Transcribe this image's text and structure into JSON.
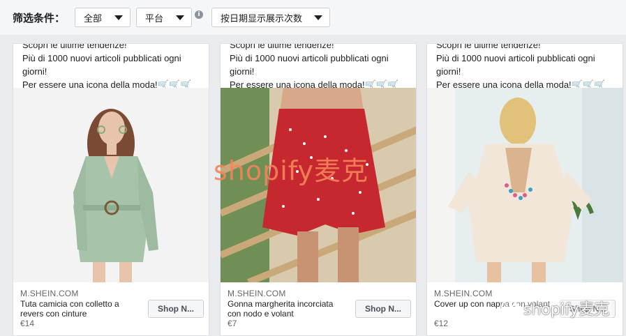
{
  "filter_bar": {
    "label": "筛选条件：",
    "dropdowns": [
      {
        "value": "全部"
      },
      {
        "value": "平台"
      },
      {
        "value": "按日期显示展示次数"
      }
    ],
    "info_icon": "i"
  },
  "ad_copy": {
    "line1": "Scopri le ultime tendenze!",
    "line2": "Più di 1000 nuovi articoli pubblicati ogni giorni!",
    "line3": "Per essere una icona della moda!🛒🛒🛒"
  },
  "cards": [
    {
      "domain": "M.SHEIN.COM",
      "title": "Tuta camicia con colletto a revers con cinture",
      "price": "€14",
      "cta": "Shop N..."
    },
    {
      "domain": "M.SHEIN.COM",
      "title": "Gonna margherita incorciata con nodo e volant",
      "price": "€7",
      "cta": "Shop N..."
    },
    {
      "domain": "M.SHEIN.COM",
      "title": "Cover up con nappa con volant",
      "price": "€12",
      "cta": "Shop N..."
    }
  ],
  "watermarks": {
    "center": "shopify麦克",
    "corner": "shopify麦克"
  },
  "icons": [
    "caret-down-icon",
    "info-icon",
    "wechat-icon"
  ],
  "colors": {
    "accent_watermark": "#f5845a",
    "page_bg": "#e9ebee"
  }
}
